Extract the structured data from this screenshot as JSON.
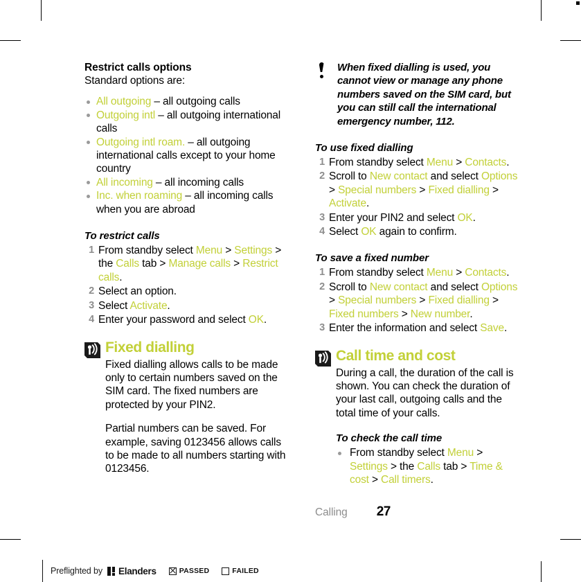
{
  "accent_color": "#c2d038",
  "number_color": "#8d8d8d",
  "left_column": {
    "restrict_options": {
      "heading": "Restrict calls options",
      "intro": "Standard options are:",
      "items": [
        {
          "term": "All outgoing",
          "desc": " – all outgoing calls"
        },
        {
          "term": "Outgoing intl",
          "desc": " – all outgoing international calls"
        },
        {
          "term": "Outgoing intl roam.",
          "desc": " – all outgoing international calls except to your home country"
        },
        {
          "term": "All incoming",
          "desc": " – all incoming calls"
        },
        {
          "term": "Inc. when roaming",
          "desc": " – all incoming calls when you are abroad"
        }
      ]
    },
    "to_restrict_calls": {
      "title": "To restrict calls",
      "steps": [
        {
          "num": "1",
          "parts": [
            {
              "t": "From standby select ",
              "a": false
            },
            {
              "t": "Menu",
              "a": true
            },
            {
              "t": " > ",
              "a": false
            },
            {
              "t": "Settings",
              "a": true
            },
            {
              "t": " > the ",
              "a": false
            },
            {
              "t": "Calls",
              "a": true
            },
            {
              "t": " tab > ",
              "a": false
            },
            {
              "t": "Manage calls",
              "a": true
            },
            {
              "t": " > ",
              "a": false
            },
            {
              "t": "Restrict calls",
              "a": true
            },
            {
              "t": ".",
              "a": false
            }
          ]
        },
        {
          "num": "2",
          "parts": [
            {
              "t": "Select an option.",
              "a": false
            }
          ]
        },
        {
          "num": "3",
          "parts": [
            {
              "t": "Select ",
              "a": false
            },
            {
              "t": "Activate",
              "a": true
            },
            {
              "t": ".",
              "a": false
            }
          ]
        },
        {
          "num": "4",
          "parts": [
            {
              "t": "Enter your password and select ",
              "a": false
            },
            {
              "t": "OK",
              "a": true
            },
            {
              "t": ".",
              "a": false
            }
          ]
        }
      ]
    },
    "fixed_dialling": {
      "icon": "signal-antenna-icon",
      "title": "Fixed dialling",
      "paragraph_1": "Fixed dialling allows calls to be made only to certain numbers saved on the SIM card. The fixed numbers are protected by your PIN2.",
      "paragraph_2": "Partial numbers can be saved. For example, saving 0123456 allows calls to be made to all numbers starting with 0123456."
    }
  },
  "right_column": {
    "note": {
      "icon": "exclamation-icon",
      "text": "When fixed dialling is used, you cannot view or manage any phone numbers saved on the SIM card, but you can still call the international emergency number, 112."
    },
    "to_use_fixed_dialling": {
      "title": "To use fixed dialling",
      "steps": [
        {
          "num": "1",
          "parts": [
            {
              "t": "From standby select ",
              "a": false
            },
            {
              "t": "Menu",
              "a": true
            },
            {
              "t": " > ",
              "a": false
            },
            {
              "t": "Contacts",
              "a": true
            },
            {
              "t": ".",
              "a": false
            }
          ]
        },
        {
          "num": "2",
          "parts": [
            {
              "t": "Scroll to ",
              "a": false
            },
            {
              "t": "New contact",
              "a": true
            },
            {
              "t": " and select ",
              "a": false
            },
            {
              "t": "Options",
              "a": true
            },
            {
              "t": " > ",
              "a": false
            },
            {
              "t": "Special numbers",
              "a": true
            },
            {
              "t": " > ",
              "a": false
            },
            {
              "t": "Fixed dialling",
              "a": true
            },
            {
              "t": " > ",
              "a": false
            },
            {
              "t": "Activate",
              "a": true
            },
            {
              "t": ".",
              "a": false
            }
          ]
        },
        {
          "num": "3",
          "parts": [
            {
              "t": "Enter your PIN2 and select ",
              "a": false
            },
            {
              "t": "OK",
              "a": true
            },
            {
              "t": ".",
              "a": false
            }
          ]
        },
        {
          "num": "4",
          "parts": [
            {
              "t": "Select ",
              "a": false
            },
            {
              "t": "OK",
              "a": true
            },
            {
              "t": " again to confirm.",
              "a": false
            }
          ]
        }
      ]
    },
    "to_save_a_fixed_number": {
      "title": "To save a fixed number",
      "steps": [
        {
          "num": "1",
          "parts": [
            {
              "t": "From standby select ",
              "a": false
            },
            {
              "t": "Menu",
              "a": true
            },
            {
              "t": " > ",
              "a": false
            },
            {
              "t": "Contacts",
              "a": true
            },
            {
              "t": ".",
              "a": false
            }
          ]
        },
        {
          "num": "2",
          "parts": [
            {
              "t": "Scroll to ",
              "a": false
            },
            {
              "t": "New contact",
              "a": true
            },
            {
              "t": " and select ",
              "a": false
            },
            {
              "t": "Options",
              "a": true
            },
            {
              "t": " > ",
              "a": false
            },
            {
              "t": "Special numbers",
              "a": true
            },
            {
              "t": " > ",
              "a": false
            },
            {
              "t": "Fixed dialling",
              "a": true
            },
            {
              "t": " > ",
              "a": false
            },
            {
              "t": "Fixed numbers",
              "a": true
            },
            {
              "t": " > ",
              "a": false
            },
            {
              "t": "New number",
              "a": true
            },
            {
              "t": ".",
              "a": false
            }
          ]
        },
        {
          "num": "3",
          "parts": [
            {
              "t": "Enter the information and select ",
              "a": false
            },
            {
              "t": "Save",
              "a": true
            },
            {
              "t": ".",
              "a": false
            }
          ]
        }
      ]
    },
    "call_time_and_cost": {
      "icon": "signal-antenna-icon",
      "title": "Call time and cost",
      "paragraph_1": "During a call, the duration of the call is shown. You can check the duration of your last call, outgoing calls and the total time of your calls.",
      "to_check_the_call_time": {
        "title": "To check the call time",
        "steps": [
          {
            "num": "•",
            "parts": [
              {
                "t": "From standby select ",
                "a": false
              },
              {
                "t": "Menu",
                "a": true
              },
              {
                "t": " > ",
                "a": false
              },
              {
                "t": "Settings",
                "a": true
              },
              {
                "t": " > the ",
                "a": false
              },
              {
                "t": "Calls",
                "a": true
              },
              {
                "t": " tab > ",
                "a": false
              },
              {
                "t": "Time & cost",
                "a": true
              },
              {
                "t": " > ",
                "a": false
              },
              {
                "t": "Call timers",
                "a": true
              },
              {
                "t": ".",
                "a": false
              }
            ]
          }
        ]
      }
    }
  },
  "footer": {
    "chapter": "Calling",
    "page_number": "27"
  },
  "preflight": {
    "label": "Preflighted by",
    "logo_word": "Elanders",
    "passed_label": "PASSED",
    "failed_label": "FAILED",
    "passed_checked": true,
    "failed_checked": false
  }
}
